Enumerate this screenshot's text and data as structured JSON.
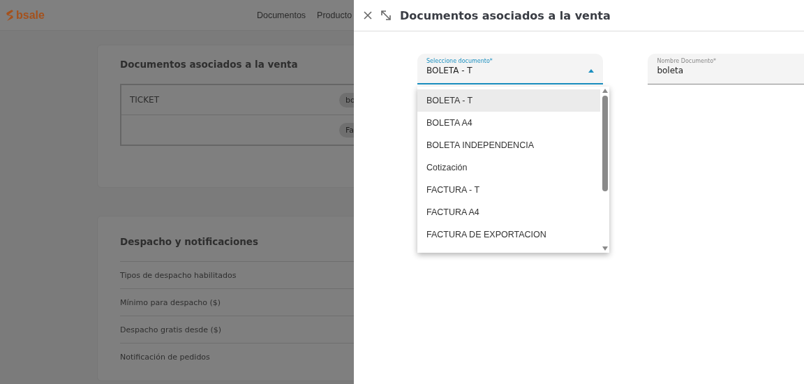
{
  "app": {
    "logo": "bsale",
    "nav": [
      {
        "label": "Documentos"
      },
      {
        "label": "Producto"
      }
    ]
  },
  "documents_card": {
    "title": "Documentos asociados a la venta",
    "rows": [
      {
        "name": "TICKET",
        "chip": "bo"
      },
      {
        "chip": "Fa"
      }
    ]
  },
  "dispatch_card": {
    "title": "Despacho y notificaciones",
    "rows": [
      "Tipos de despacho habilitados",
      "Mínimo para despacho ($)",
      "Despacho gratis desde ($)",
      "Notificación de pedidos"
    ]
  },
  "drawer": {
    "title": "Documentos asociados a la venta",
    "document_select": {
      "label": "Seleccione documento*",
      "value": "BOLETA - T",
      "expanded": true,
      "options": [
        {
          "label": "BOLETA - T",
          "selected": true
        },
        {
          "label": "BOLETA A4",
          "selected": false
        },
        {
          "label": "BOLETA INDEPENDENCIA",
          "selected": false
        },
        {
          "label": "Cotización",
          "selected": false
        },
        {
          "label": "FACTURA - T",
          "selected": false
        },
        {
          "label": "FACTURA A4",
          "selected": false
        },
        {
          "label": "FACTURA DE EXPORTACION",
          "selected": false
        }
      ]
    },
    "name_field": {
      "label": "Nombre Documento*",
      "value": "boleta"
    }
  }
}
